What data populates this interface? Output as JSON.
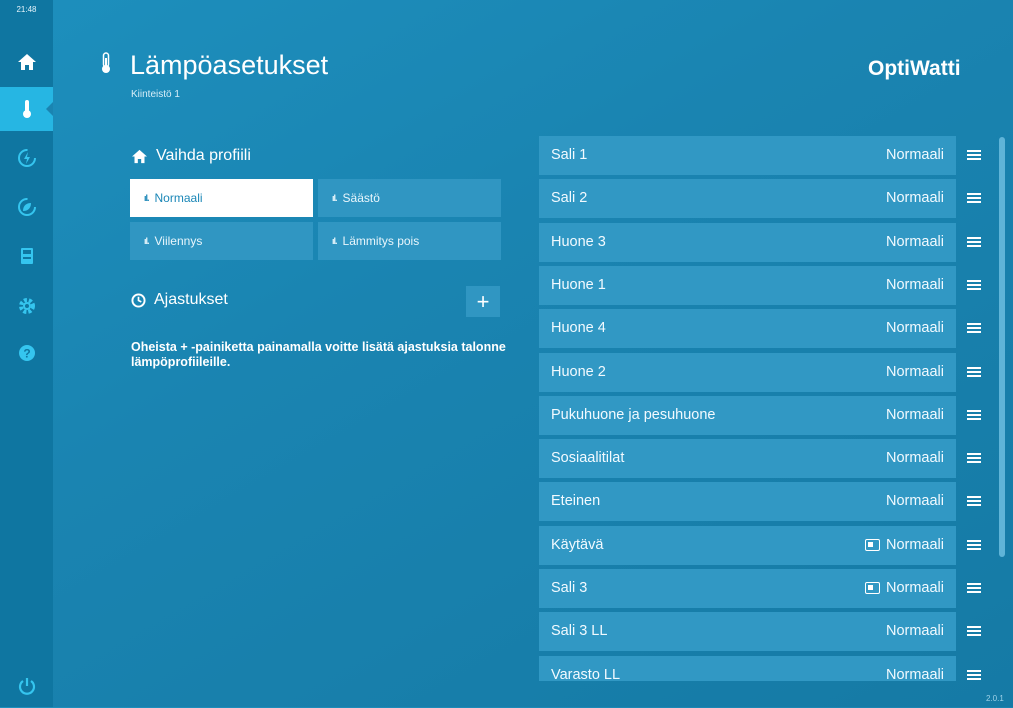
{
  "sidebar": {
    "clock": "21:48",
    "items": [
      {
        "icon": "home-icon",
        "color": "#ffffff"
      },
      {
        "icon": "thermometer-icon",
        "color": "#ffffff"
      },
      {
        "icon": "lightning-icon",
        "color": "#35c5ef"
      },
      {
        "icon": "leaf-icon",
        "color": "#35c5ef"
      },
      {
        "icon": "meter-icon",
        "color": "#35c5ef"
      },
      {
        "icon": "gear-icon",
        "color": "#35c5ef"
      },
      {
        "icon": "help-icon",
        "color": "#35c5ef"
      },
      {
        "icon": "power-icon",
        "color": "#35c5ef"
      }
    ]
  },
  "header": {
    "title": "Lämpöasetukset",
    "subtitle": "Kiinteistö 1",
    "logo": "OptiWatti"
  },
  "profiles": {
    "title": "Vaihda profiili",
    "buttons": [
      "Normaali",
      "Säästö",
      "Viilennys",
      "Lämmitys pois"
    ],
    "selected": "Normaali"
  },
  "schedules": {
    "title": "Ajastukset",
    "add_label": "+",
    "info": "Oheista + -painiketta painamalla voitte lisätä ajastuksia talonne lämpöprofiileille."
  },
  "rooms": [
    {
      "name": "Sali 1",
      "profile": "Normaali",
      "scheduled": false
    },
    {
      "name": "Sali 2",
      "profile": "Normaali",
      "scheduled": false
    },
    {
      "name": "Huone 3",
      "profile": "Normaali",
      "scheduled": false
    },
    {
      "name": "Huone 1",
      "profile": "Normaali",
      "scheduled": false
    },
    {
      "name": "Huone 4",
      "profile": "Normaali",
      "scheduled": false
    },
    {
      "name": "Huone 2",
      "profile": "Normaali",
      "scheduled": false
    },
    {
      "name": "Pukuhuone ja pesuhuone",
      "profile": "Normaali",
      "scheduled": false
    },
    {
      "name": "Sosiaalitilat",
      "profile": "Normaali",
      "scheduled": false
    },
    {
      "name": "Eteinen",
      "profile": "Normaali",
      "scheduled": false
    },
    {
      "name": "Käytävä",
      "profile": "Normaali",
      "scheduled": true
    },
    {
      "name": "Sali 3",
      "profile": "Normaali",
      "scheduled": true
    },
    {
      "name": "Sali 3 LL",
      "profile": "Normaali",
      "scheduled": false
    },
    {
      "name": "Varasto LL",
      "profile": "Normaali",
      "scheduled": false
    }
  ],
  "version": "2.0.1"
}
